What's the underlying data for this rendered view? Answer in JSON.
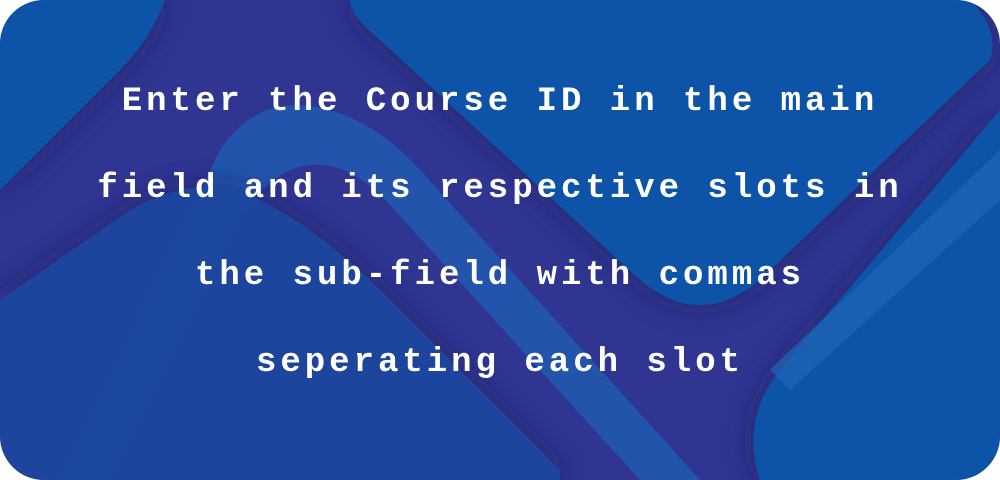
{
  "message": {
    "lines": [
      "Enter the Course ID in the main",
      "field and its respective slots in",
      "the sub-field with commas",
      "seperating each slot"
    ]
  },
  "colors": {
    "background": "#2f3590",
    "shape": "#1052a8",
    "stripe": "#1f66b8",
    "text": "#ffffff"
  }
}
